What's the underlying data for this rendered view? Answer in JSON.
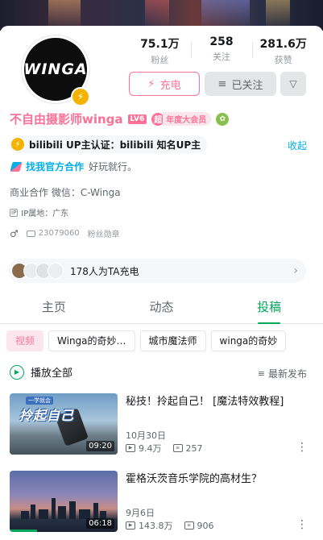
{
  "profile": {
    "avatar_text": "WINGA",
    "stats": [
      {
        "value": "75.1万",
        "label": "粉丝"
      },
      {
        "value": "258",
        "label": "关注"
      },
      {
        "value": "281.6万",
        "label": "获赞"
      }
    ],
    "charge_label": "充电",
    "follow_label": "已关注",
    "username": "不自由摄影师winga",
    "level": "LV6",
    "vip_icon": "超",
    "vip_label": "年度大会员",
    "cert_text": "bilibili UP主认证：bilibili 知名UP主",
    "collapse_label": "收起",
    "coop_link": "找我官方合作",
    "coop_tag": "好玩就行。",
    "biz_text": "商业合作 微信：C-Winga",
    "ip_icon": "IP",
    "ip_text": "IP属地：广东",
    "uid": "23079060",
    "fan_medal": "粉丝勋章",
    "charge_count_text": "178人为TA充电"
  },
  "tabs": [
    {
      "label": "主页"
    },
    {
      "label": "动态"
    },
    {
      "label": "投稿"
    }
  ],
  "chips": [
    {
      "label": "视频"
    },
    {
      "label": "Winga的奇妙…"
    },
    {
      "label": "城市魔法师"
    },
    {
      "label": "winga的奇妙"
    }
  ],
  "list": {
    "play_all": "播放全部",
    "sort_label": "最新发布"
  },
  "videos": [
    {
      "thumb_sub": "一学就会",
      "thumb_title": "拎起自己",
      "duration": "09:20",
      "progress": 0,
      "title": "秘技！拎起自己！ [魔法特效教程]",
      "date": "10月30日",
      "views": "9.4万",
      "danmaku": "257"
    },
    {
      "duration": "06:18",
      "progress": 0.25,
      "title": "霍格沃茨音乐学院的高材生？",
      "date": "9月6日",
      "views": "143.8万",
      "danmaku": "906"
    }
  ],
  "colors": {
    "brand_pink": "#fb7299",
    "brand_blue": "#00aeec",
    "active_tab": "#00a85a"
  }
}
